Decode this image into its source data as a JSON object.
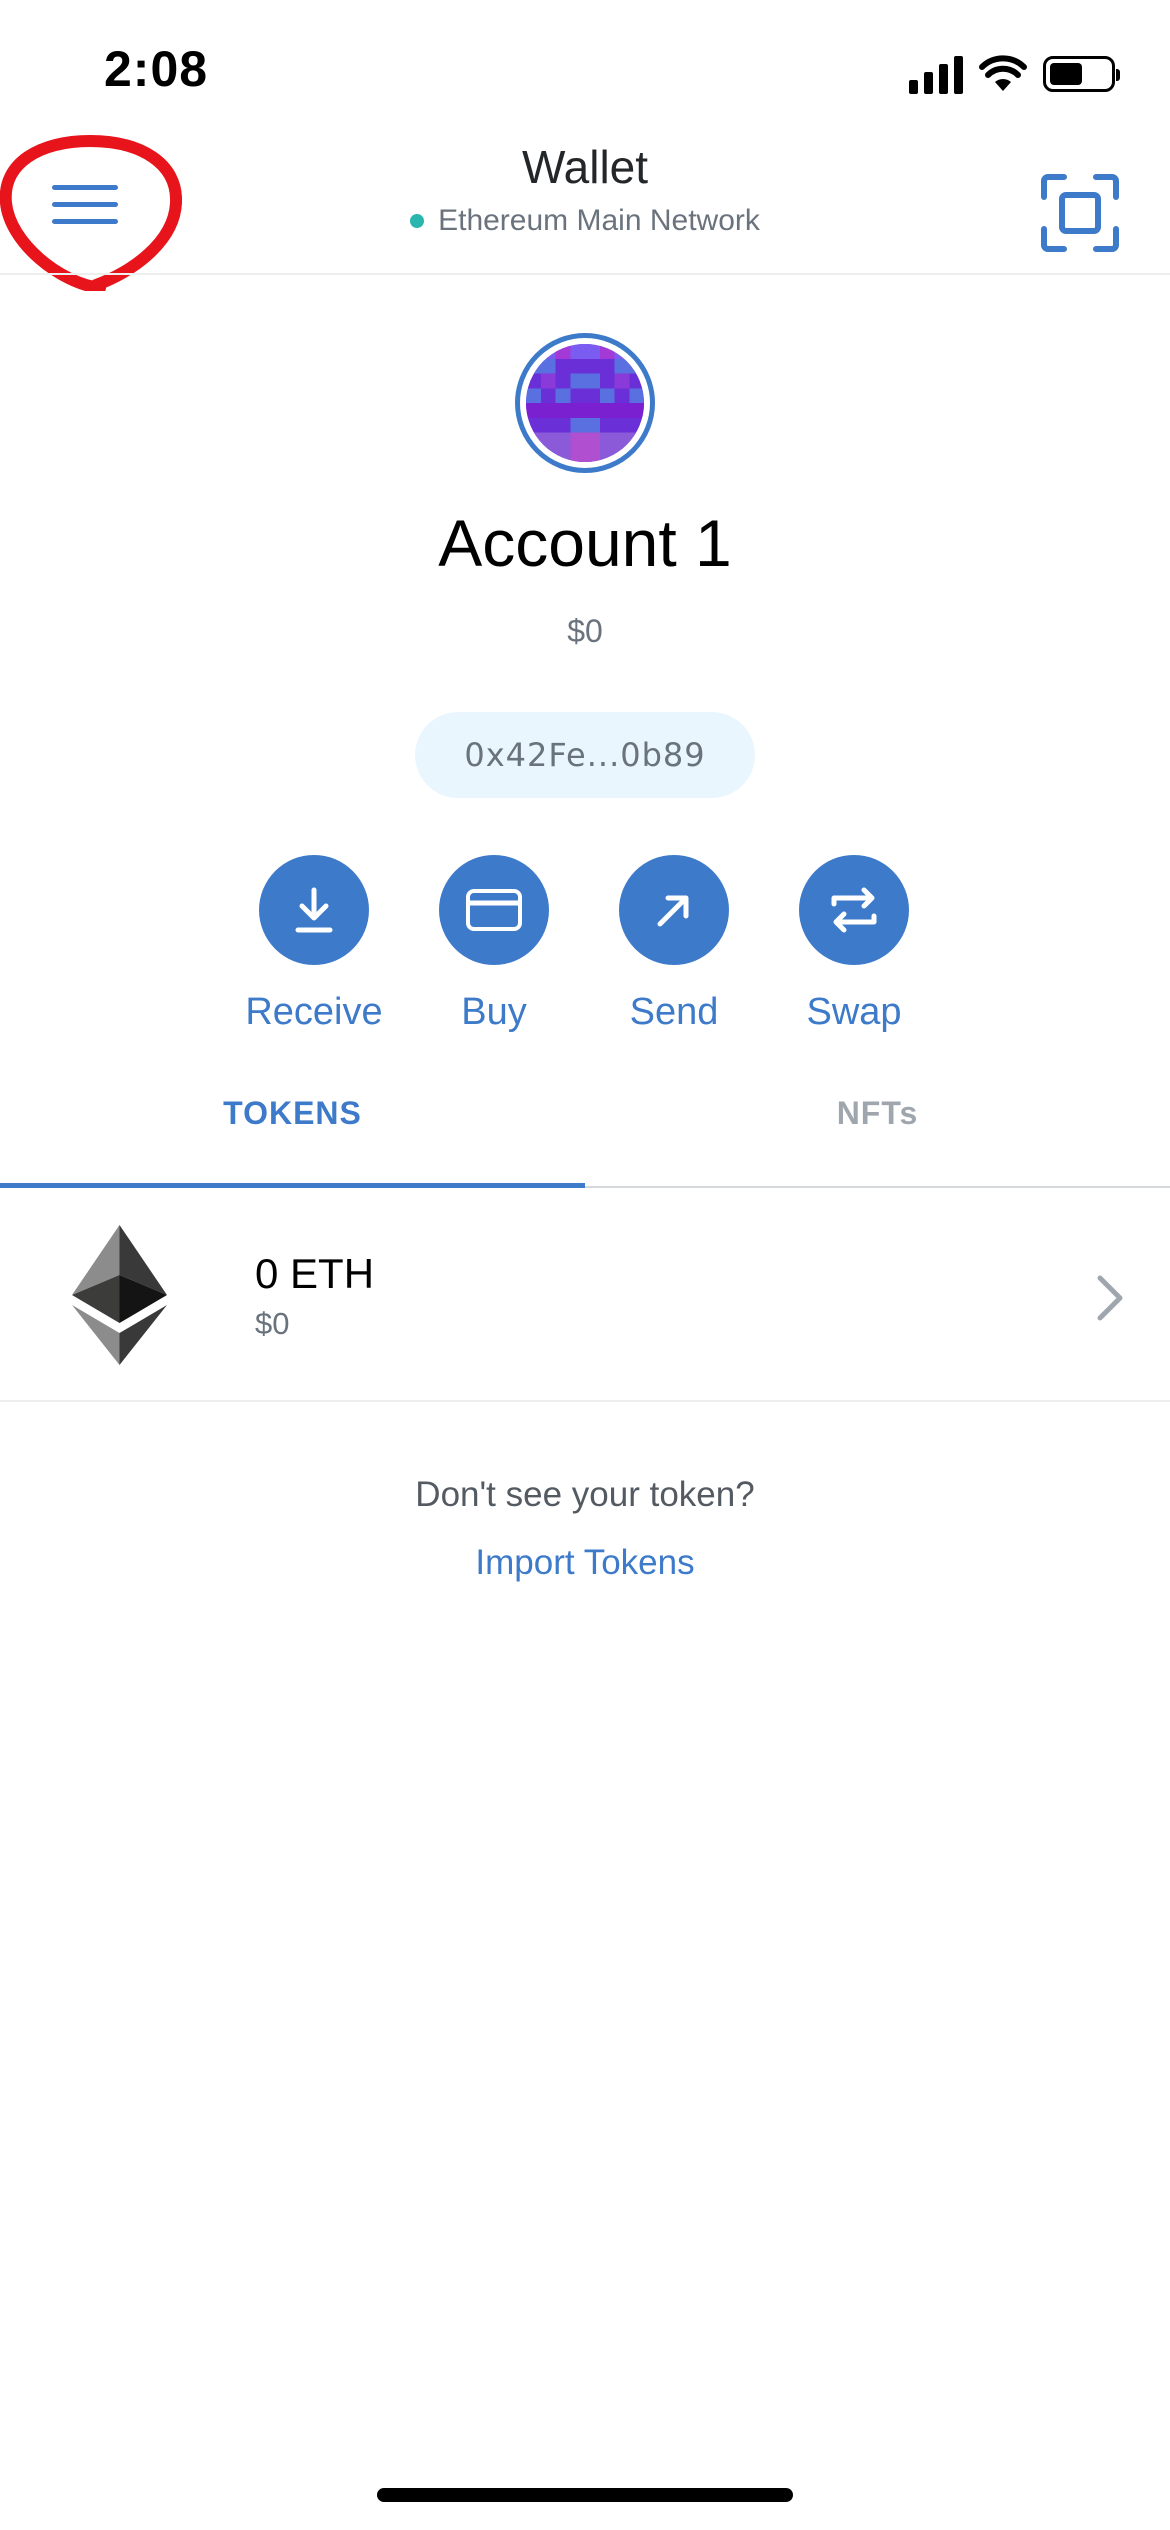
{
  "status_bar": {
    "time": "2:08"
  },
  "header": {
    "title": "Wallet",
    "network": "Ethereum Main Network",
    "menu_icon": "hamburger-menu-icon",
    "scan_icon": "qr-scan-icon",
    "annotation_color": "#e8141c"
  },
  "account": {
    "name": "Account 1",
    "balance": "$0",
    "address": "0x42Fe...0b89"
  },
  "actions": [
    {
      "label": "Receive",
      "icon": "download-icon"
    },
    {
      "label": "Buy",
      "icon": "card-icon"
    },
    {
      "label": "Send",
      "icon": "arrow-up-right-icon"
    },
    {
      "label": "Swap",
      "icon": "swap-arrows-icon"
    }
  ],
  "tabs": [
    {
      "label": "TOKENS",
      "active": true
    },
    {
      "label": "NFTs",
      "active": false
    }
  ],
  "tokens": [
    {
      "amount": "0 ETH",
      "fiat": "$0",
      "icon": "ethereum-icon"
    }
  ],
  "footer": {
    "prompt": "Don't see your token?",
    "import_label": "Import Tokens"
  },
  "colors": {
    "accent": "#3d7ac9",
    "network_dot": "#29b6af",
    "address_bg": "#eaf6fd"
  }
}
